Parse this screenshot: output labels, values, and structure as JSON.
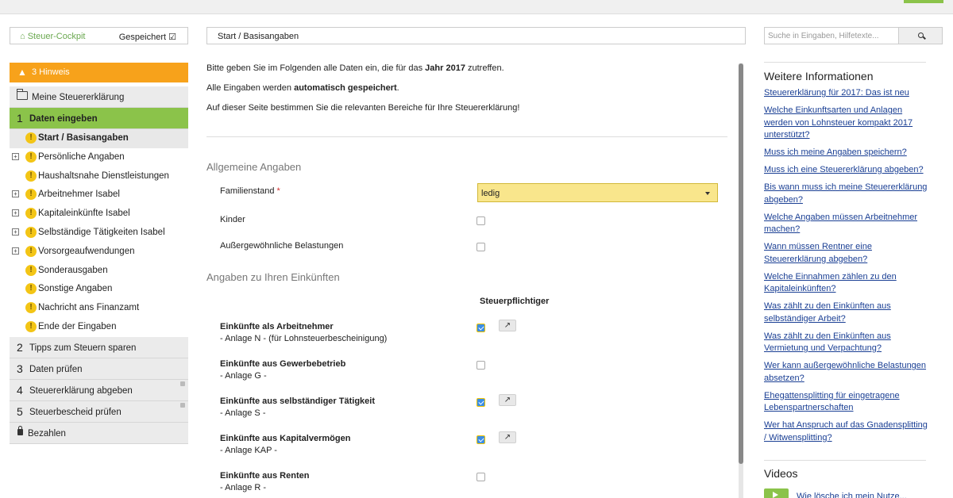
{
  "top": {
    "cockpit_label": "Steuer-Cockpit",
    "saved_label": "Gespeichert"
  },
  "hint": {
    "label": "3 Hinweis"
  },
  "nav": {
    "header": "Meine Steuererklärung",
    "steps": [
      {
        "num": "1",
        "label": "Daten eingeben"
      },
      {
        "num": "2",
        "label": "Tipps zum Steuern sparen"
      },
      {
        "num": "3",
        "label": "Daten prüfen"
      },
      {
        "num": "4",
        "label": "Steuererklärung abgeben"
      },
      {
        "num": "5",
        "label": "Steuerbescheid prüfen"
      }
    ],
    "subitems": [
      {
        "label": "Start / Basisangaben",
        "expandable": false
      },
      {
        "label": "Persönliche Angaben",
        "expandable": true
      },
      {
        "label": "Haushaltsnahe Dienstleistungen",
        "expandable": false
      },
      {
        "label": "Arbeitnehmer Isabel",
        "expandable": true
      },
      {
        "label": "Kapitaleinkünfte Isabel",
        "expandable": true
      },
      {
        "label": "Selbständige Tätigkeiten Isabel",
        "expandable": true
      },
      {
        "label": "Vorsorgeaufwendungen",
        "expandable": true
      },
      {
        "label": "Sonderausgaben",
        "expandable": false
      },
      {
        "label": "Sonstige Angaben",
        "expandable": false
      },
      {
        "label": "Nachricht ans Finanzamt",
        "expandable": false
      },
      {
        "label": "Ende der Eingaben",
        "expandable": false
      }
    ],
    "pay": "Bezahlen"
  },
  "breadcrumb": "Start / Basisangaben",
  "intro": {
    "p1_pre": "Bitte geben Sie im Folgenden alle Daten ein, die für das ",
    "p1_bold": "Jahr 2017",
    "p1_post": " zutreffen.",
    "p2_pre": "Alle Eingaben werden ",
    "p2_bold": "automatisch gespeichert",
    "p2_post": ".",
    "p3": "Auf dieser Seite bestimmen Sie die relevanten Bereiche für Ihre Steuererklärung!"
  },
  "general": {
    "title": "Allgemeine Angaben",
    "familienstand_label": "Familienstand",
    "familienstand_value": "ledig",
    "kinder_label": "Kinder",
    "belastungen_label": "Außergewöhnliche Belastungen"
  },
  "income": {
    "title": "Angaben zu Ihren Einkünften",
    "column": "Steuerpflichtiger",
    "rows": [
      {
        "title": "Einkünfte als Arbeitnehmer",
        "sub": "- Anlage N - (für Lohnsteuerbescheinigung)",
        "checked": true
      },
      {
        "title": "Einkünfte aus Gewerbebetrieb",
        "sub": "- Anlage G -",
        "checked": false
      },
      {
        "title": "Einkünfte aus selbständiger Tätigkeit",
        "sub": "- Anlage S -",
        "checked": true
      },
      {
        "title": "Einkünfte aus Kapitalvermögen",
        "sub": "- Anlage KAP -",
        "checked": true
      },
      {
        "title": "Einkünfte aus Renten",
        "sub": "- Anlage R -",
        "checked": false
      }
    ]
  },
  "search": {
    "placeholder": "Suche in Eingaben, Hilfetexte..."
  },
  "info": {
    "title": "Weitere Informationen",
    "links": [
      "Steuererklärung für 2017: Das ist neu",
      "Welche Einkunftsarten und Anlagen werden von Lohnsteuer kompakt 2017 unterstützt?",
      "Muss ich meine Angaben speichern?",
      "Muss ich eine Steuererklärung abgeben?",
      "Bis wann muss ich meine Steuererklärung abgeben?",
      "Welche Angaben müssen Arbeitnehmer machen?",
      "Wann müssen Rentner eine Steuererklärung abgeben?",
      "Welche Einnahmen zählen zu den Kapitaleinkünften?",
      "Was zählt zu den Einkünften aus selbständiger Arbeit?",
      "Was zählt zu den Einkünften aus Vermietung und Verpachtung?",
      "Wer kann außergewöhnliche Belastungen absetzen?",
      "Ehegattensplitting für eingetragene Lebenspartnerschaften",
      "Wer hat Anspruch auf das Gnadensplitting / Witwensplitting?"
    ]
  },
  "videos": {
    "title": "Videos",
    "first": "Wie lösche ich mein Nutze..."
  }
}
